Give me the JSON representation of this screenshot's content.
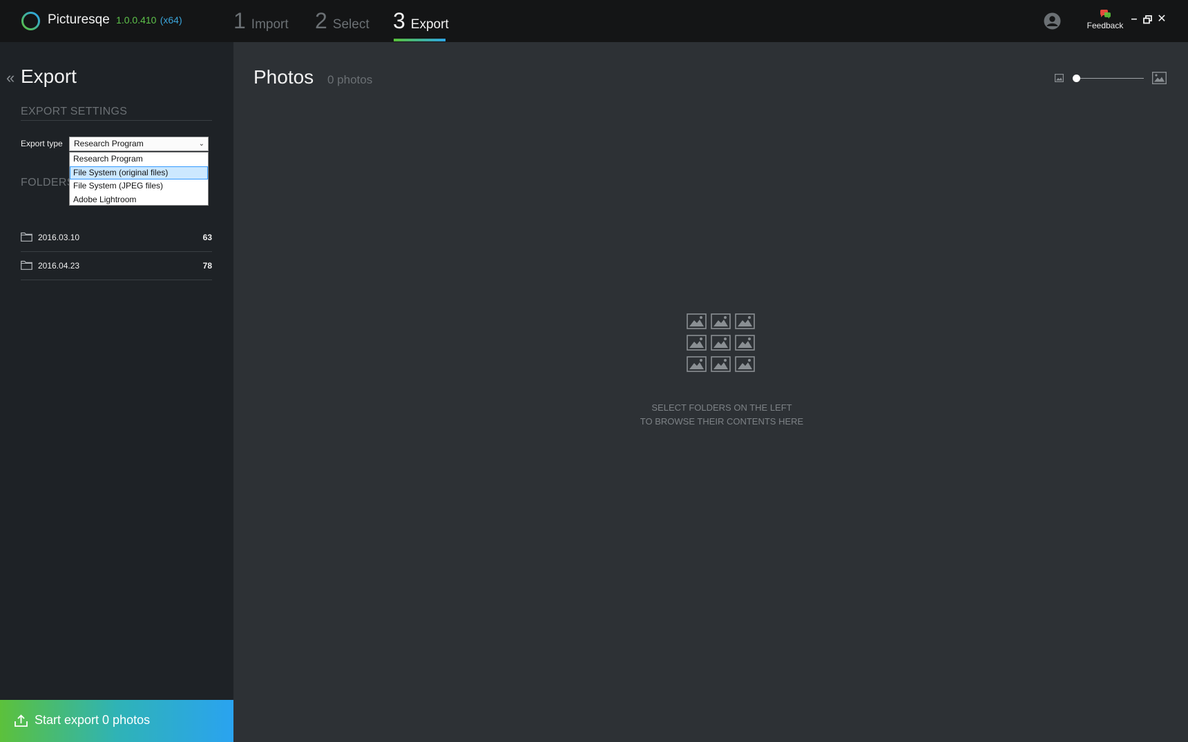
{
  "app": {
    "name": "Picturesqe",
    "version": "1.0.0.410",
    "arch": "(x64)"
  },
  "steps": [
    {
      "num": "1",
      "label": "Import"
    },
    {
      "num": "2",
      "label": "Select"
    },
    {
      "num": "3",
      "label": "Export"
    }
  ],
  "active_step": "Export",
  "header": {
    "feedback_label": "Feedback",
    "icons": [
      "user-icon",
      "feedback-icon",
      "minimize-icon",
      "restore-icon",
      "close-icon"
    ]
  },
  "sidebar": {
    "title": "Export",
    "export_settings_heading": "EXPORT SETTINGS",
    "export_type_label": "Export type",
    "export_type_value": "Research Program",
    "dropdown_options": [
      "Research Program",
      "File System (original files)",
      "File System (JPEG files)",
      "Adobe Lightroom"
    ],
    "highlighted_option": "File System (original files)",
    "folders_heading": "FOLDERS",
    "folders": [
      {
        "name": "2016.03.10",
        "count": "63"
      },
      {
        "name": "2016.04.23",
        "count": "78"
      }
    ],
    "export_button_label": "Start export 0 photos"
  },
  "main": {
    "title": "Photos",
    "photo_count": "0 photos",
    "thumbnail_size": 0.0,
    "empty_line1": "SELECT FOLDERS ON THE LEFT",
    "empty_line2": "TO BROWSE THEIR CONTENTS HERE"
  },
  "colors": {
    "topbar": "#141516",
    "sidebar": "#1e2226",
    "main": "#2d3135",
    "accent_green": "#5cc13b",
    "accent_blue": "#2aa3f0"
  }
}
